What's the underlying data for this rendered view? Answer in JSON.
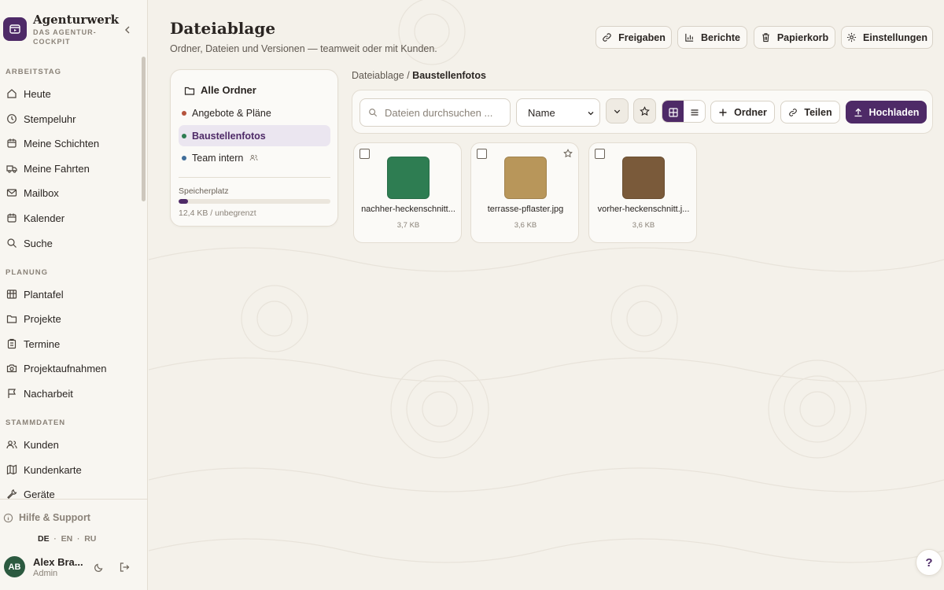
{
  "brand": {
    "name": "Agenturwerk",
    "tagline_1": "DAS AGENTUR-",
    "tagline_2": "COCKPIT"
  },
  "sidebar": {
    "sections": [
      {
        "title": "ARBEITSTAG",
        "items": [
          {
            "label": "Heute",
            "icon": "home-icon"
          },
          {
            "label": "Stempeluhr",
            "icon": "clock-icon"
          },
          {
            "label": "Meine Schichten",
            "icon": "calendar-icon"
          },
          {
            "label": "Meine Fahrten",
            "icon": "truck-icon"
          },
          {
            "label": "Mailbox",
            "icon": "mail-icon"
          },
          {
            "label": "Kalender",
            "icon": "calendar-icon"
          },
          {
            "label": "Suche",
            "icon": "search-icon"
          }
        ]
      },
      {
        "title": "PLANUNG",
        "items": [
          {
            "label": "Plantafel",
            "icon": "board-icon"
          },
          {
            "label": "Projekte",
            "icon": "folder-icon"
          },
          {
            "label": "Termine",
            "icon": "clipboard-icon"
          },
          {
            "label": "Projektaufnahmen",
            "icon": "camera-icon"
          },
          {
            "label": "Nacharbeit",
            "icon": "flag-icon"
          }
        ]
      },
      {
        "title": "STAMMDATEN",
        "items": [
          {
            "label": "Kunden",
            "icon": "users-icon"
          },
          {
            "label": "Kundenkarte",
            "icon": "map-icon"
          },
          {
            "label": "Geräte",
            "icon": "wrench-icon"
          }
        ]
      }
    ],
    "help": "Hilfe & Support",
    "languages": [
      "DE",
      "EN",
      "RU"
    ],
    "active_language": "DE",
    "user": {
      "initials": "AB",
      "name": "Alex Bra...",
      "role": "Admin"
    }
  },
  "page": {
    "title": "Dateiablage",
    "subtitle": "Ordner, Dateien und Versionen — teamweit oder mit Kunden."
  },
  "header_buttons": {
    "shares": "Freigaben",
    "reports": "Berichte",
    "trash": "Papierkorb",
    "settings": "Einstellungen"
  },
  "folders": {
    "root": "Alle Ordner",
    "items": [
      {
        "label": "Angebote & Pläne",
        "color": "#b5533c"
      },
      {
        "label": "Baustellenfotos",
        "color": "#2e7d52",
        "active": true
      },
      {
        "label": "Team intern",
        "color": "#3f6d99",
        "shared": true
      }
    ],
    "storage": {
      "label": "Speicherplatz",
      "used_fraction": 0.06,
      "value": "12,4 KB / unbegrenzt"
    }
  },
  "breadcrumb": {
    "root": "Dateiablage",
    "separator": "/",
    "current": "Baustellenfotos"
  },
  "toolbar": {
    "search_placeholder": "Dateien durchsuchen ...",
    "sort_value": "Name",
    "sort_options": [
      "Name"
    ],
    "new_folder": "Ordner",
    "share": "Teilen",
    "upload": "Hochladen"
  },
  "files": [
    {
      "name": "nachher-heckenschnitt...",
      "size": "3,7 KB",
      "color": "#2e7d52"
    },
    {
      "name": "terrasse-pflaster.jpg",
      "size": "3,6 KB",
      "color": "#b8965a"
    },
    {
      "name": "vorher-heckenschnitt.j...",
      "size": "3,6 KB",
      "color": "#7a5a3a"
    }
  ],
  "help_fab": "?",
  "colors": {
    "accent": "#4e2a67",
    "background": "#f4f1ea"
  }
}
